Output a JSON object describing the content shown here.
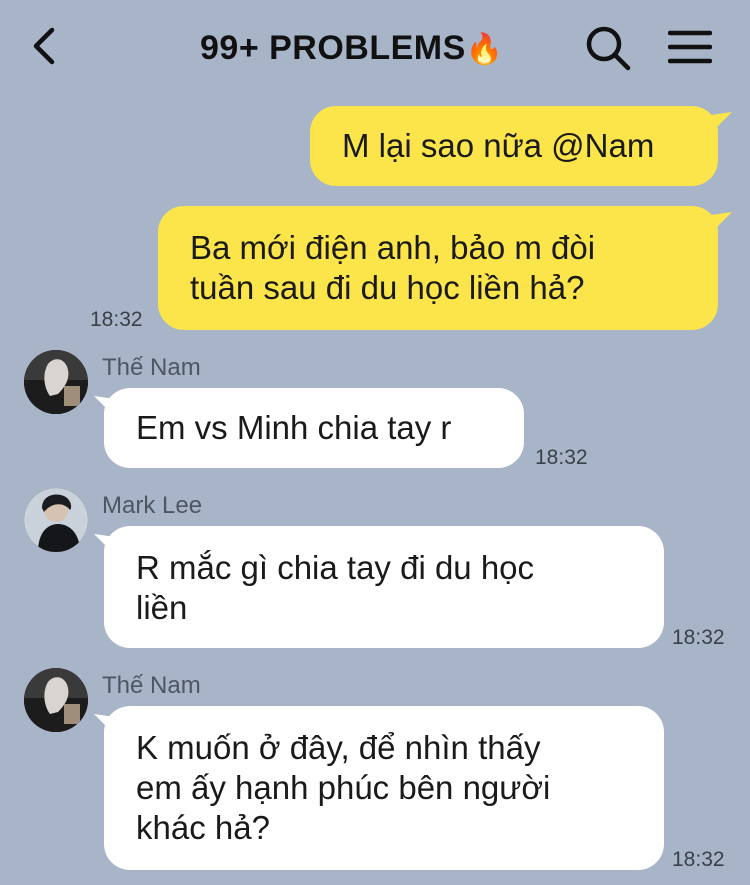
{
  "header": {
    "title": "99+ PROBLEMS",
    "title_emoji": "🔥"
  },
  "messages": [
    {
      "direction": "out",
      "text": "M lại sao nữa @Nam",
      "time": ""
    },
    {
      "direction": "out",
      "text": "Ba mới điện anh, bảo m đòi\ntuần sau đi du học liền hả?",
      "time": "18:32"
    },
    {
      "direction": "in",
      "sender": "Thế Nam",
      "text": "Em vs Minh chia tay r",
      "time": "18:32"
    },
    {
      "direction": "in",
      "sender": "Mark Lee",
      "text": "R mắc gì chia tay đi du học\nliền",
      "time": "18:32"
    },
    {
      "direction": "in",
      "sender": "Thế Nam",
      "text": "K muốn ở đây, để nhìn thấy\nem ấy hạnh phúc bên người\nkhác hả?",
      "time": "18:32"
    }
  ],
  "colors": {
    "background": "#a8b5c8",
    "outgoing_bubble": "#fbe54a",
    "incoming_bubble": "#ffffff"
  },
  "icons": {
    "back": "chevron-left-icon",
    "search": "search-icon",
    "menu": "hamburger-menu-icon"
  }
}
